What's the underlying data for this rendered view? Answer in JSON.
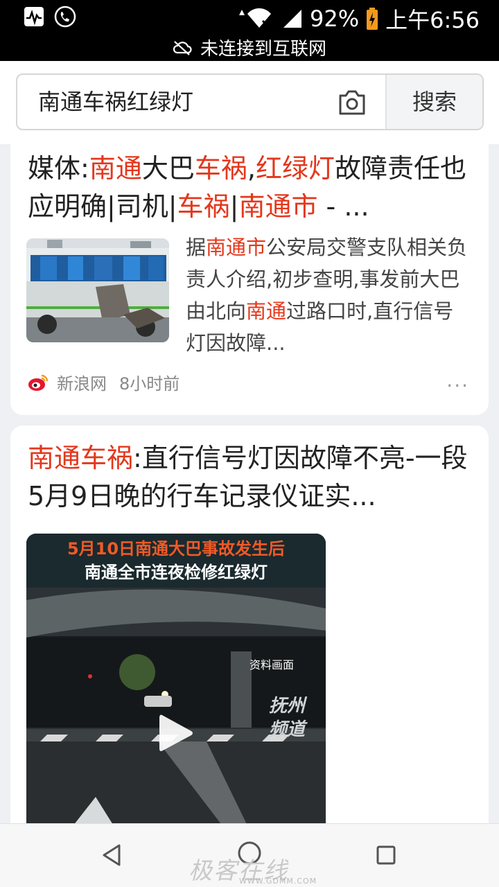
{
  "status_bar": {
    "battery": "92%",
    "time": "上午6:56",
    "network_notice": "未连接到互联网"
  },
  "search": {
    "query": "南通车祸红绿灯",
    "button_label": "搜索"
  },
  "results": [
    {
      "title_parts": [
        "媒体:",
        "南通",
        "大巴",
        "车祸",
        ",",
        "红绿灯",
        "故障责任也应明确|司机|",
        "车祸",
        "|",
        "南通市",
        " - ..."
      ],
      "snippet_parts": [
        "据",
        "南通市",
        "公安局交警支队相关负责人介绍,初步查明,事发前大巴由北向",
        "南通",
        "过路口时,直行信号灯因故障..."
      ],
      "source": "新浪网",
      "time": "8小时前",
      "more": "···"
    },
    {
      "title_parts": [
        "南通车祸",
        ":直行信号灯因故障不亮-一段5月9日晚的行车记录仪证实..."
      ],
      "video_caption_1": "5月10日南通大巴事故发生后",
      "video_caption_2": "南通全市连夜检修红绿灯",
      "video_tag": "资料画面",
      "video_logo_1": "抚州",
      "video_logo_2": "频道"
    }
  ],
  "watermark": "极客在线",
  "watermark_url": "WWW.GDMM.COM",
  "colors": {
    "highlight": "#e4371c",
    "status_bar_bg": "#000000",
    "page_bg": "#eef0f3"
  }
}
